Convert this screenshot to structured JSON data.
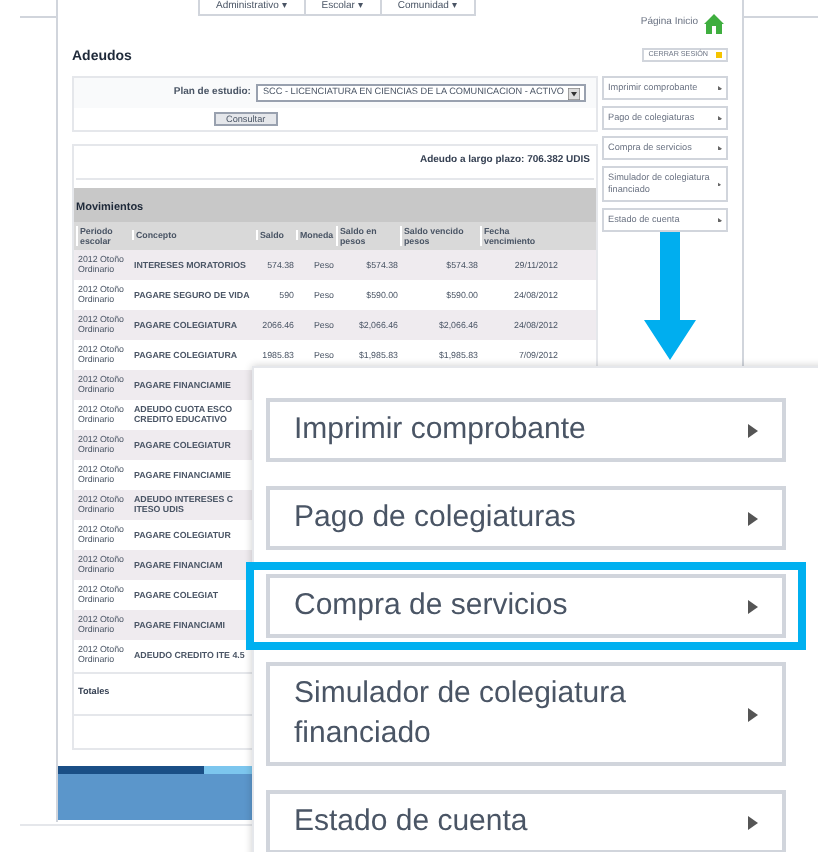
{
  "nav_tabs": [
    "Administrativo ▾",
    "Escolar ▾",
    "Comunidad ▾"
  ],
  "home_link": "Página Inicio",
  "title": "Adeudos",
  "logout_button": "CERRAR SESIÓN",
  "plan": {
    "label": "Plan de estudio:",
    "value": "SCC - LICENCIATURA EN CIENCIAS DE LA COMUNICACION - ACTIVO",
    "button": "Consultar"
  },
  "long_term_debt": "Adeudo a largo plazo: 706.382 UDIS",
  "section_title": "Movimientos",
  "table": {
    "columns": [
      "Periodo escolar",
      "Concepto",
      "Saldo",
      "Moneda",
      "Saldo en pesos",
      "Saldo vencido pesos",
      "Fecha vencimiento"
    ],
    "rows": [
      [
        "2012 Otoño Ordinario",
        "INTERESES MORATORIOS",
        "574.38",
        "Peso",
        "$574.38",
        "$574.38",
        "29/11/2012"
      ],
      [
        "2012 Otoño Ordinario",
        "PAGARE SEGURO DE VIDA",
        "590",
        "Peso",
        "$590.00",
        "$590.00",
        "24/08/2012"
      ],
      [
        "2012 Otoño Ordinario",
        "PAGARE COLEGIATURA",
        "2066.46",
        "Peso",
        "$2,066.46",
        "$2,066.46",
        "24/08/2012"
      ],
      [
        "2012 Otoño Ordinario",
        "PAGARE COLEGIATURA",
        "1985.83",
        "Peso",
        "$1,985.83",
        "$1,985.83",
        "7/09/2012"
      ],
      [
        "2012 Otoño Ordinario",
        "PAGARE FINANCIAMIE"
      ],
      [
        "2012 Otoño Ordinario",
        "ADEUDO CUOTA ESCO CREDITO EDUCATIVO"
      ],
      [
        "2012 Otoño Ordinario",
        "PAGARE COLEGIATUR"
      ],
      [
        "2012 Otoño Ordinario",
        "PAGARE FINANCIAMIE"
      ],
      [
        "2012 Otoño Ordinario",
        "ADEUDO INTERESES C ITESO UDIS"
      ],
      [
        "2012 Otoño Ordinario",
        "PAGARE COLEGIATUR"
      ],
      [
        "2012 Otoño Ordinario",
        "PAGARE FINANCIAM"
      ],
      [
        "2012 Otoño Ordinario",
        "PAGARE COLEGIAT"
      ],
      [
        "2012 Otoño Ordinario",
        "PAGARE FINANCIAMI"
      ],
      [
        "2012 Otoño Ordinario",
        "ADEUDO CREDITO ITE 4.5"
      ]
    ],
    "totals_label": "Totales"
  },
  "side_menu": [
    "Imprimir comprobante",
    "Pago de colegiaturas",
    "Compra de servicios",
    "Simulador de colegiatura financiado",
    "Estado de cuenta"
  ],
  "zoomed_menu": [
    {
      "label": "Imprimir comprobante",
      "selected": false
    },
    {
      "label": "Pago de colegiaturas",
      "selected": false
    },
    {
      "label": "Compra de servicios",
      "selected": true
    },
    {
      "label": "Simulador de colegiatura financiado",
      "selected": false
    },
    {
      "label": "Estado de cuenta",
      "selected": false
    }
  ]
}
